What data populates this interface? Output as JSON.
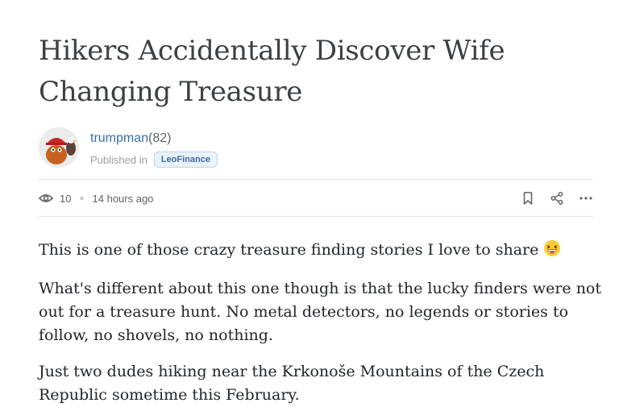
{
  "post": {
    "title": "Hikers Accidentally Discover Wife Changing Treasure",
    "author": {
      "name": "trumpman",
      "reputation": "(82)",
      "avatar_icon": "avatar-image"
    },
    "published_prefix": "Published in",
    "community": "LeoFinance",
    "views": "10",
    "time_ago": "14 hours ago",
    "paragraphs": [
      {
        "text": "This is one of those crazy treasure finding stories I love to share",
        "emoji": "grinning-squinting-face-emoji"
      },
      {
        "text": "What's different about this one though is that the lucky finders were not out for a treasure hunt. No metal detectors, no legends or stories to follow, no shovels, no nothing."
      },
      {
        "text": "Just two dudes hiking near the Krkonoše Mountains of the Czech Republic sometime this February."
      }
    ]
  },
  "icons": {
    "views": "eye-icon",
    "bookmark": "bookmark-icon",
    "share": "share-icon",
    "more": "more-icon"
  },
  "colors": {
    "title": "#3c4043",
    "link": "#3a6ea5",
    "badge_bg": "#eaf2fb",
    "muted": "#9aa0a6",
    "body_text": "#212529"
  }
}
